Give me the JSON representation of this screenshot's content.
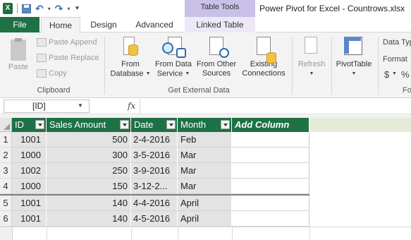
{
  "titlebar": {
    "excel_icon_letter": "X",
    "table_tools": "Table Tools",
    "document_title": "Power Pivot for Excel - Countrows.xlsx"
  },
  "tabs": {
    "file": "File",
    "home": "Home",
    "design": "Design",
    "advanced": "Advanced",
    "linked_table": "Linked Table"
  },
  "ribbon": {
    "clipboard": {
      "group_label": "Clipboard",
      "paste": "Paste",
      "paste_append": "Paste Append",
      "paste_replace": "Paste Replace",
      "copy": "Copy"
    },
    "external_data": {
      "group_label": "Get External Data",
      "from_database_line1": "From",
      "from_database_line2": "Database",
      "from_data_service_line1": "From Data",
      "from_data_service_line2": "Service",
      "from_other_sources_line1": "From Other",
      "from_other_sources_line2": "Sources",
      "existing_connections_line1": "Existing",
      "existing_connections_line2": "Connections"
    },
    "refresh": "Refresh",
    "pivottable": "PivotTable",
    "formatting": {
      "data_type": "Data Typ",
      "format": "Format",
      "currency_symbol": "$",
      "percent_symbol": "%",
      "group_label_partial": "Fo"
    }
  },
  "formula_bar": {
    "name_box": "[ID]",
    "fx": "fx",
    "formula": ""
  },
  "grid": {
    "headers": [
      "ID",
      "Sales Amount",
      "Date",
      "Month"
    ],
    "add_column": "Add Column",
    "row_numbers": [
      "1",
      "2",
      "3",
      "4",
      "5",
      "6"
    ],
    "rows": [
      {
        "id": "1001",
        "sales": "500",
        "date": "2-4-2016",
        "month": "Feb"
      },
      {
        "id": "1000",
        "sales": "300",
        "date": "3-5-2016",
        "month": "Mar"
      },
      {
        "id": "1002",
        "sales": "250",
        "date": "3-9-2016",
        "month": "Mar"
      },
      {
        "id": "1000",
        "sales": "150",
        "date": "3-12-2...",
        "month": "Mar"
      },
      {
        "id": "1001",
        "sales": "140",
        "date": "4-4-2016",
        "month": "April"
      },
      {
        "id": "1001",
        "sales": "140",
        "date": "4-5-2016",
        "month": "April"
      }
    ]
  },
  "colors": {
    "file_tab": "#1e7145",
    "header_green": "#1e7145",
    "table_tools": "#c9c0e8",
    "cell_gray": "#e3e3e3"
  }
}
